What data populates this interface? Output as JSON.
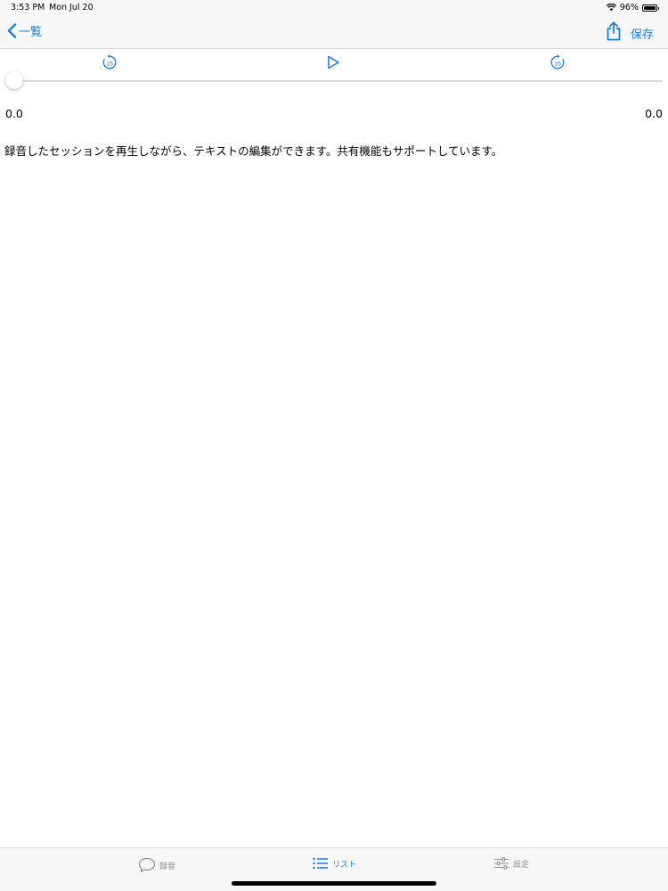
{
  "status_bar": {
    "time": "3:53 PM",
    "date": "Mon Jul 20",
    "battery": "96%"
  },
  "nav": {
    "back_label": "一覧",
    "save_label": "保存"
  },
  "player": {
    "current_time": "0.0",
    "total_time": "0.0",
    "skip_back_seconds": "15",
    "skip_forward_seconds": "15",
    "progress": 0.0
  },
  "note": {
    "text": "録音したセッションを再生しながら、テキストの編集ができます。共有機能もサポートしています。"
  },
  "tabs": [
    {
      "label": "録音",
      "icon": "speech-bubble-icon",
      "selected": false
    },
    {
      "label": "リスト",
      "icon": "list-icon",
      "selected": true
    },
    {
      "label": "設定",
      "icon": "sliders-icon",
      "selected": false
    }
  ],
  "colors": {
    "accent": "#1a7de3",
    "inactive": "#8e8e93",
    "bar_bg": "#f7f7f8"
  }
}
